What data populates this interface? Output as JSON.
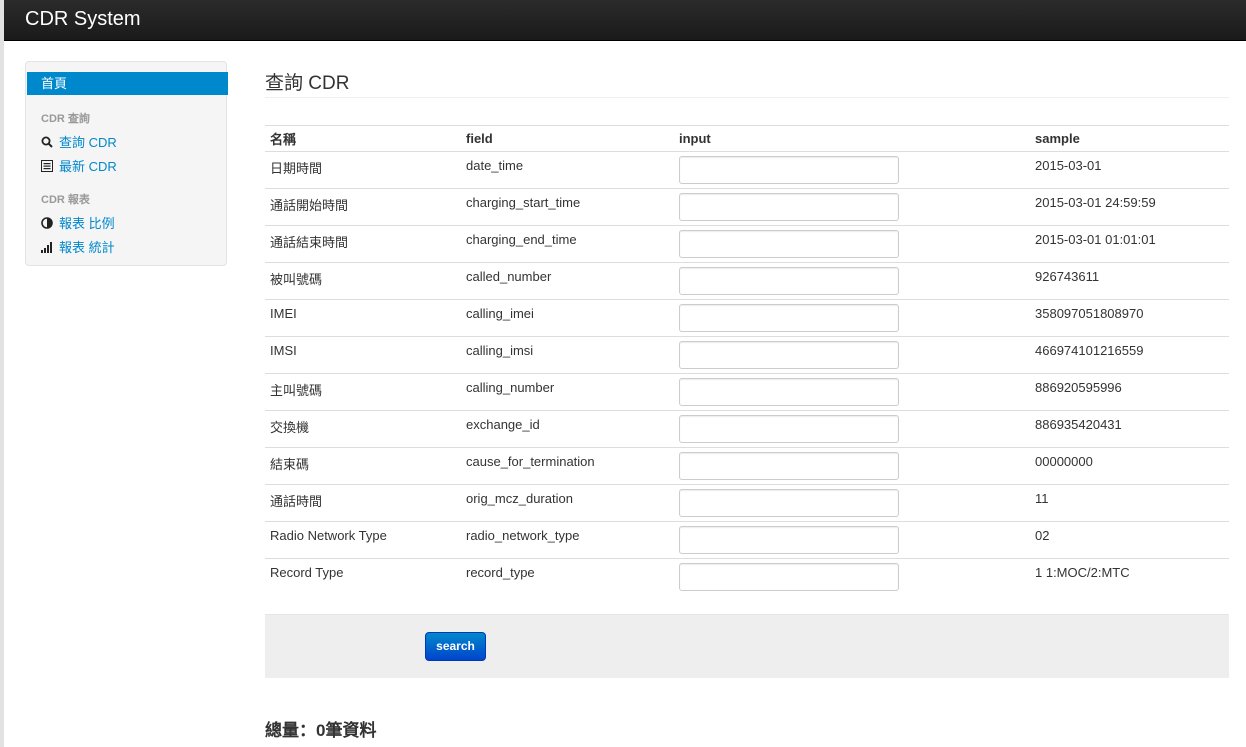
{
  "app": {
    "brand": "CDR System"
  },
  "sidebar": {
    "active_item": "首頁",
    "sections": [
      {
        "header": "CDR 查詢",
        "items": [
          {
            "icon": "search-icon",
            "label": "查詢 CDR"
          },
          {
            "icon": "list-icon",
            "label": "最新 CDR"
          }
        ]
      },
      {
        "header": "CDR 報表",
        "items": [
          {
            "icon": "adjust-icon",
            "label": "報表 比例"
          },
          {
            "icon": "signal-bars-icon",
            "label": "報表 統計"
          }
        ]
      }
    ]
  },
  "main": {
    "title": "查詢 CDR",
    "columns": [
      "名稱",
      "field",
      "input",
      "sample"
    ],
    "rows": [
      {
        "name": "日期時間",
        "field": "date_time",
        "input": "",
        "sample": "2015-03-01"
      },
      {
        "name": "通話開始時間",
        "field": "charging_start_time",
        "input": "",
        "sample": "2015-03-01 24:59:59"
      },
      {
        "name": "通話結束時間",
        "field": "charging_end_time",
        "input": "",
        "sample": "2015-03-01 01:01:01"
      },
      {
        "name": "被叫號碼",
        "field": "called_number",
        "input": "",
        "sample": "926743611"
      },
      {
        "name": "IMEI",
        "field": "calling_imei",
        "input": "",
        "sample": "358097051808970"
      },
      {
        "name": "IMSI",
        "field": "calling_imsi",
        "input": "",
        "sample": "466974101216559"
      },
      {
        "name": "主叫號碼",
        "field": "calling_number",
        "input": "",
        "sample": "886920595996"
      },
      {
        "name": "交換機",
        "field": "exchange_id",
        "input": "",
        "sample": "886935420431"
      },
      {
        "name": "結束碼",
        "field": "cause_for_termination",
        "input": "",
        "sample": "00000000"
      },
      {
        "name": "通話時間",
        "field": "orig_mcz_duration",
        "input": "",
        "sample": "11"
      },
      {
        "name": "Radio Network Type",
        "field": "radio_network_type",
        "input": "",
        "sample": "02"
      },
      {
        "name": "Record Type",
        "field": "record_type",
        "input": "",
        "sample": "1 1:MOC/2:MTC"
      }
    ],
    "search_label": "search",
    "total_text": "總量：0筆資料"
  },
  "colors": {
    "accent": "#0088cc",
    "navbar": "#222222",
    "button": "#0055cc"
  }
}
